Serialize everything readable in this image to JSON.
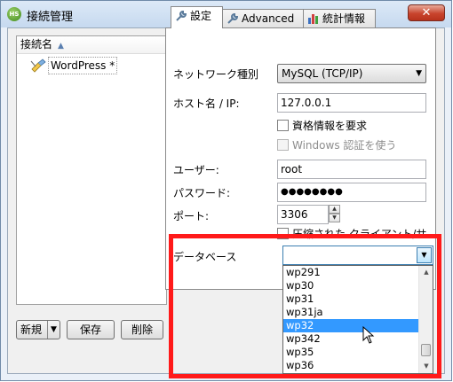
{
  "window": {
    "title": "接続管理",
    "app_icon_text": "HS",
    "close_glyph": "✕"
  },
  "sidebar": {
    "header": "接続名",
    "sort_glyph": "▲",
    "items": [
      {
        "label": "WordPress *"
      }
    ]
  },
  "buttons": {
    "new_label": "新規",
    "new_arrow": "▼",
    "save_label": "保存",
    "delete_label": "削除"
  },
  "tabs": [
    {
      "label": "設定",
      "icon": "wrench-icon",
      "active": true
    },
    {
      "label": "Advanced",
      "icon": "wrench-icon",
      "active": false
    },
    {
      "label": "統計情報",
      "icon": "bar-chart-icon",
      "active": false
    }
  ],
  "settings": {
    "network_type_label": "ネットワーク種別",
    "network_type_value": "MySQL (TCP/IP)",
    "host_label": "ホスト名 / IP:",
    "host_value": "127.0.0.1",
    "require_credentials_label": "資格情報を要求",
    "windows_auth_label": "Windows 認証を使う",
    "user_label": "ユーザー:",
    "user_value": "root",
    "password_label": "パスワード:",
    "password_value": "●●●●●●●●",
    "port_label": "ポート:",
    "port_value": "3306",
    "compressed_label": "圧縮された クライアント/サ",
    "database_label": "データベース",
    "database_value": ""
  },
  "database_dropdown": {
    "options": [
      "wp291",
      "wp30",
      "wp31",
      "wp31ja",
      "wp32",
      "wp342",
      "wp35",
      "wp36"
    ],
    "highlighted": "wp32"
  },
  "colors": {
    "highlight": "#ff1a1a",
    "selection": "#3399ff"
  }
}
